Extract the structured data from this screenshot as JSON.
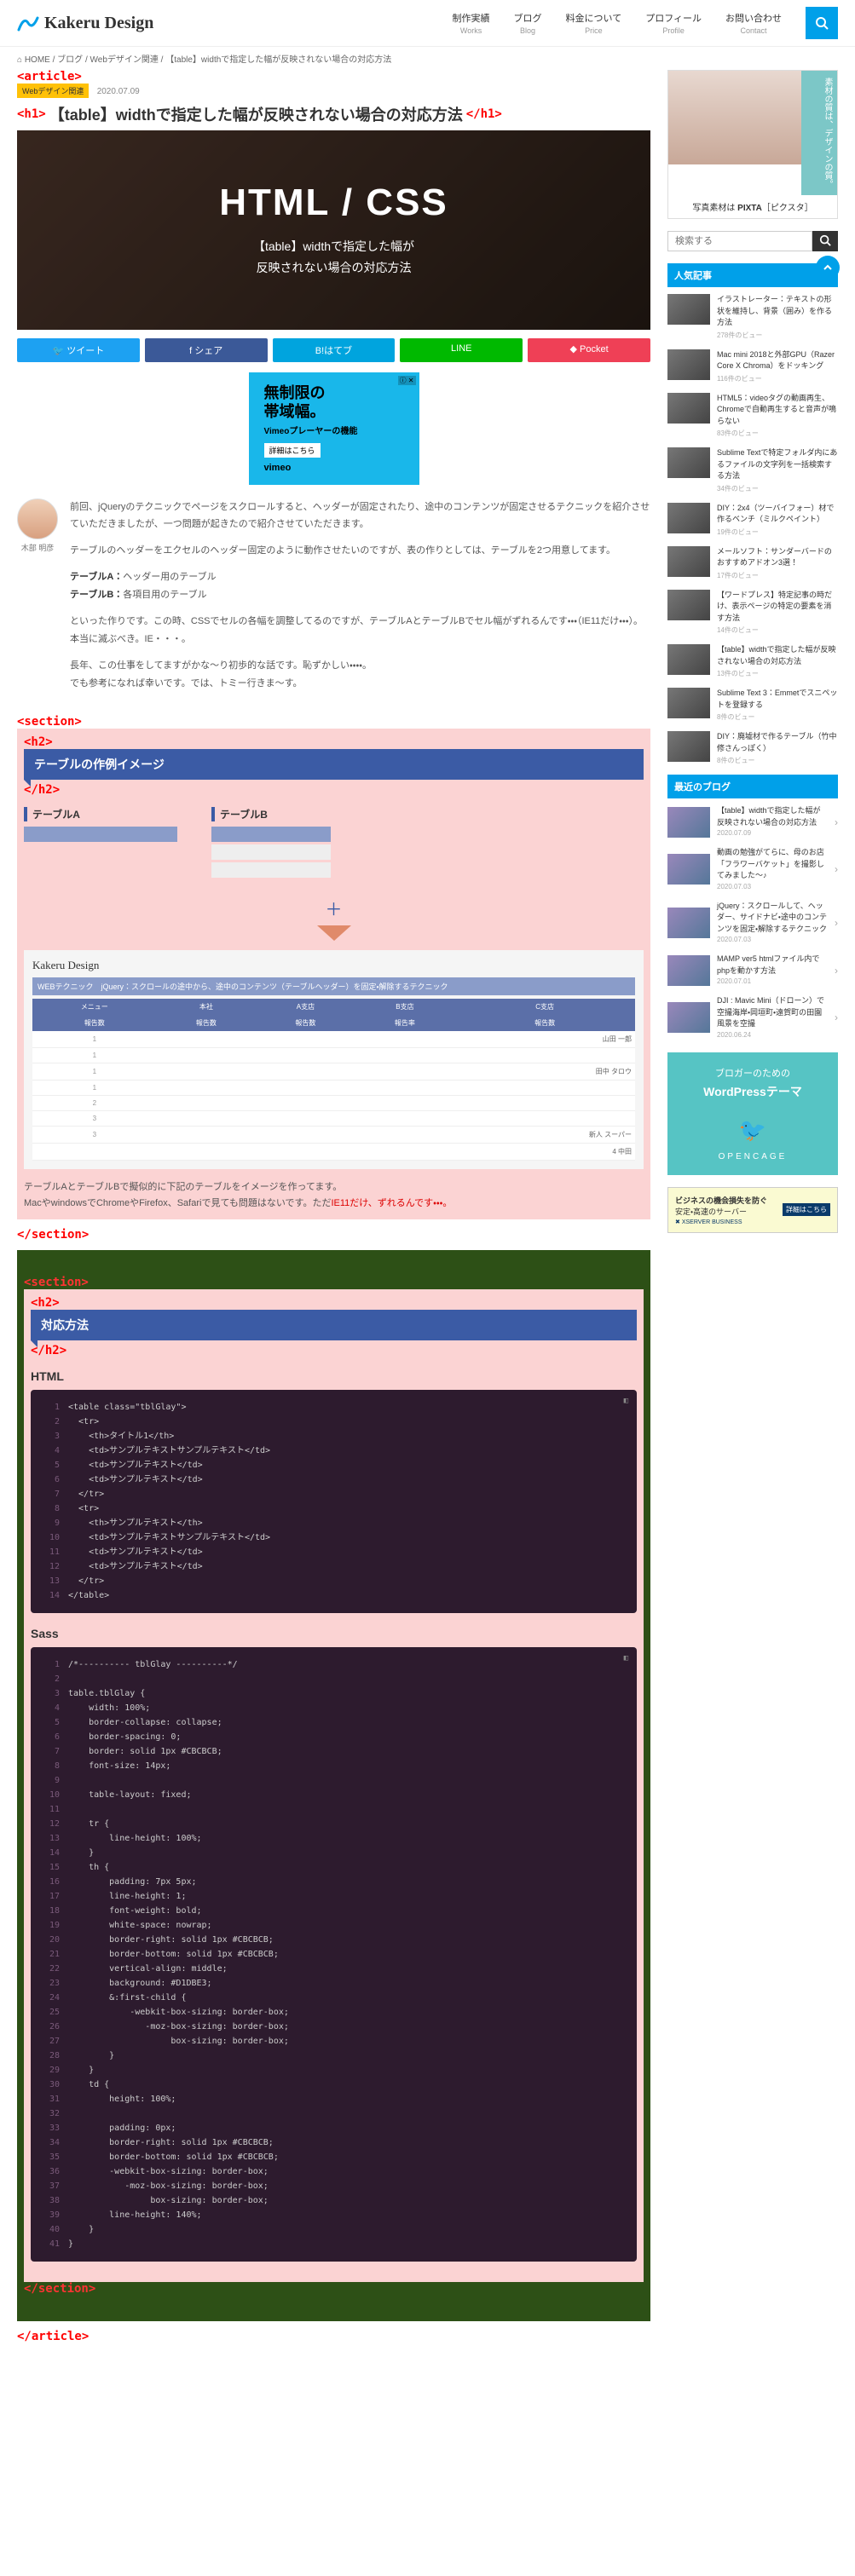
{
  "header": {
    "logo": "Kakeru Design",
    "nav": [
      {
        "label": "制作実績",
        "en": "Works"
      },
      {
        "label": "ブログ",
        "en": "Blog"
      },
      {
        "label": "料金について",
        "en": "Price"
      },
      {
        "label": "プロフィール",
        "en": "Profile"
      },
      {
        "label": "お問い合わせ",
        "en": "Contact"
      }
    ]
  },
  "breadcrumb": [
    "HOME",
    "ブログ",
    "Webデザイン関連",
    "【table】widthで指定した幅が反映されない場合の対応方法"
  ],
  "post": {
    "category": "Webデザイン関連",
    "date": "2020.07.09",
    "title": "【table】widthで指定した幅が反映されない場合の対応方法",
    "hero_big": "HTML / CSS",
    "hero_sub1": "【table】widthで指定した幅が",
    "hero_sub2": "反映されない場合の対応方法"
  },
  "share": {
    "twitter": "ツイート",
    "facebook": "シェア",
    "hatena": "B!はてブ",
    "line": "LINE",
    "pocket": "Pocket"
  },
  "ad_vimeo": {
    "headline1": "無制限の",
    "headline2": "帯域幅。",
    "sub": "Vimeoプレーヤーの機能",
    "cta": "詳細はこちら",
    "brand": "vimeo"
  },
  "author": {
    "name": "木部 明彦"
  },
  "lead": {
    "p1": "前回、jQueryのテクニックでページをスクロールすると、ヘッダーが固定されたり、途中のコンテンツが固定させるテクニックを紹介させていただきましたが、一つ問題が起きたので紹介させていただきます。",
    "p2": "テーブルのヘッダーをエクセルのヘッダー固定のように動作させたいのですが、表の作りとしては、テーブルを2つ用意してます。",
    "labelA": "テーブルA：",
    "descA": "ヘッダー用のテーブル",
    "labelB": "テーブルB：",
    "descB": "各項目用のテーブル",
    "p3": "といった作りです。この時、CSSでセルの各幅を調整してるのですが、テーブルAとテーブルBでセル幅がずれるんです・・・（IE11だけ・・・）。",
    "p3b": "本当に滅ぶべき。IE・・・。",
    "p4": "長年、この仕事をしてますがかな～り初歩的な話です。恥ずかしい・・・・。",
    "p4b": "でも参考になれば幸いです。では、トミー行きま～す。"
  },
  "sec1": {
    "title": "テーブルの作例イメージ",
    "tableA": "テーブルA",
    "tableB": "テーブルB",
    "mock": {
      "logo": "Kakeru Design",
      "title": "WEBテクニック　jQuery：スクロールの途中から、途中のコンテンツ（テーブルヘッダー）を固定・解除するテクニック",
      "headers": [
        "メニュー",
        "本社",
        "A支店",
        "B支店",
        "C支店"
      ],
      "subheaders": [
        "報告数",
        "報告数",
        "報告数",
        "報告率",
        "報告数"
      ],
      "rows": [
        {
          "sub": "1",
          "nm": "山田 一郎"
        },
        {
          "sub": "1",
          "nm": ""
        },
        {
          "sub": "1",
          "nm": "田中 タロウ"
        },
        {
          "sub": "1",
          "nm": ""
        },
        {
          "sub": "2",
          "nm": ""
        },
        {
          "sub": "3",
          "nm": ""
        },
        {
          "sub": "3",
          "nm": "新人 スーパー"
        },
        {
          "sub": "",
          "nm": "4 中田"
        }
      ]
    },
    "explain1": "テーブルAとテーブルBで擬似的に下記のテーブルをイメージを作ってます。",
    "explain2_a": "MacやwindowsでChromeやFirefox、Safariで見ても問題はないです。ただ",
    "explain2_b": "IE11だけ、ずれるんです・・・。"
  },
  "sec2": {
    "title": "対応方法",
    "html_label": "HTML",
    "sass_label": "Sass",
    "html_code": "<table class=\"tblGlay\">\n  <tr>\n    <th>タイトル1</th>\n    <td>サンプルテキストサンプルテキスト</td>\n    <td>サンプルテキスト</td>\n    <td>サンプルテキスト</td>\n  </tr>\n  <tr>\n    <th>サンプルテキスト</th>\n    <td>サンプルテキストサンプルテキスト</td>\n    <td>サンプルテキスト</td>\n    <td>サンプルテキスト</td>\n  </tr>\n</table>",
    "sass_code": "/*---------- tblGlay ----------*/\n\ntable.tblGlay {\n    width: 100%;\n    border-collapse: collapse;\n    border-spacing: 0;\n    border: solid 1px #CBCBCB;\n    font-size: 14px;\n\n    table-layout: fixed;\n\n    tr {\n        line-height: 100%;\n    }\n    th {\n        padding: 7px 5px;\n        line-height: 1;\n        font-weight: bold;\n        white-space: nowrap;\n        border-right: solid 1px #CBCBCB;\n        border-bottom: solid 1px #CBCBCB;\n        vertical-align: middle;\n        background: #D1DBE3;\n        &:first-child {\n            -webkit-box-sizing: border-box;\n               -moz-box-sizing: border-box;\n                    box-sizing: border-box;\n        }\n    }\n    td {\n        height: 100%;\n\n        padding: 0px;\n        border-right: solid 1px #CBCBCB;\n        border-bottom: solid 1px #CBCBCB;\n        -webkit-box-sizing: border-box;\n           -moz-box-sizing: border-box;\n                box-sizing: border-box;\n        line-height: 140%;\n    }\n}"
  },
  "tags": {
    "article_open": "<article>",
    "article_close": "</article>",
    "h1_open": "<h1>",
    "h1_close": "</h1>",
    "section_open": "<section>",
    "section_close": "</section>",
    "h2_open": "<h2>",
    "h2_close": "</h2>"
  },
  "sidebar": {
    "pixta": {
      "vertical": "素材の質は、デザインの質。",
      "caption_a": "写真素材は ",
      "caption_b": "PIXTA",
      "caption_c": "［ピクスタ］"
    },
    "search_placeholder": "検索する",
    "popular_head": "人気記事",
    "popular": [
      {
        "title": "イラストレーター：テキストの形状を維持し、背景（囲み）を作る方法",
        "views": "278件のビュー"
      },
      {
        "title": "Mac mini 2018と外部GPU（Razer Core X Chroma）をドッキング",
        "views": "116件のビュー"
      },
      {
        "title": "HTML5：videoタグの動画再生、Chromeで自動再生すると音声が鳴らない",
        "views": "83件のビュー"
      },
      {
        "title": "Sublime Textで特定フォルダ内にあるファイルの文字列を一括検索する方法",
        "views": "34件のビュー"
      },
      {
        "title": "DIY：2x4（ツーバイフォー）材で作るベンチ（ミルクペイント）",
        "views": "19件のビュー"
      },
      {
        "title": "メールソフト：サンダーバードのおすすめアドオン3選！",
        "views": "17件のビュー"
      },
      {
        "title": "【ワードプレス】特定記事の時だけ、表示ページの特定の要素を消す方法",
        "views": "14件のビュー"
      },
      {
        "title": "【table】widthで指定した幅が反映されない場合の対応方法",
        "views": "13件のビュー"
      },
      {
        "title": "Sublime Text 3：Emmetでスニペットを登録する",
        "views": "8件のビュー"
      },
      {
        "title": "DIY：廃墟材で作るテーブル（竹中 修さんっぽく）",
        "views": "8件のビュー"
      }
    ],
    "recent_head": "最近のブログ",
    "recent": [
      {
        "title": "【table】widthで指定した幅が反映されない場合の対応方法",
        "date": "2020.07.09"
      },
      {
        "title": "動画の勉強がてらに、母のお店「フラワーバケット」を撮影してみました～♪",
        "date": "2020.07.03"
      },
      {
        "title": "jQuery：スクロールして、ヘッダー、サイドナビ・途中のコンテンツを固定・解除するテクニック",
        "date": "2020.07.03"
      },
      {
        "title": "MAMP ver5 htmlファイル内でphpを動かす方法",
        "date": "2020.07.01"
      },
      {
        "title": "DJI : Mavic Mini（ドローン）で空撮海岸・岡垣町・遠賀町の田園風景を空撮",
        "date": "2020.06.24"
      }
    ],
    "banner": {
      "t1": "ブロガーのための",
      "t2": "WordPressテーマ",
      "t3": "OPENCAGE"
    },
    "xserver": {
      "txt1": "ビジネスの機会損失を防ぐ",
      "txt2": "安定・高速のサーバー",
      "btn": "詳細はこちら",
      "brand": "XSERVER BUSINESS"
    }
  }
}
